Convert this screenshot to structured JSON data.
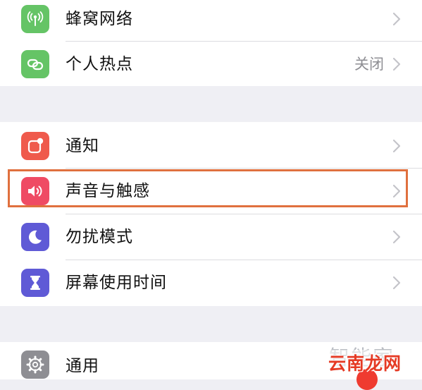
{
  "groups": [
    {
      "items": [
        {
          "label": "蜂窝网络",
          "value": "",
          "icon": "cellular-antenna-icon",
          "color": "#65c466"
        },
        {
          "label": "个人热点",
          "value": "关闭",
          "icon": "hotspot-chain-icon",
          "color": "#65c466"
        }
      ]
    },
    {
      "items": [
        {
          "label": "通知",
          "value": "",
          "icon": "notifications-icon",
          "color": "#ef5a4c"
        },
        {
          "label": "声音与触感",
          "value": "",
          "icon": "speaker-icon",
          "color": "#ef4b64"
        },
        {
          "label": "勿扰模式",
          "value": "",
          "icon": "moon-icon",
          "color": "#5f5ad6"
        },
        {
          "label": "屏幕使用时间",
          "value": "",
          "icon": "hourglass-icon",
          "color": "#5f5ad6"
        }
      ]
    },
    {
      "items": [
        {
          "label": "通用",
          "value": "",
          "icon": "gear-icon",
          "color": "#8e8e93"
        }
      ]
    }
  ],
  "highlight": {
    "target": "声音与触感",
    "color": "#e0703e"
  },
  "watermark": {
    "faded_text": "智能家",
    "text": "云南龙网"
  }
}
